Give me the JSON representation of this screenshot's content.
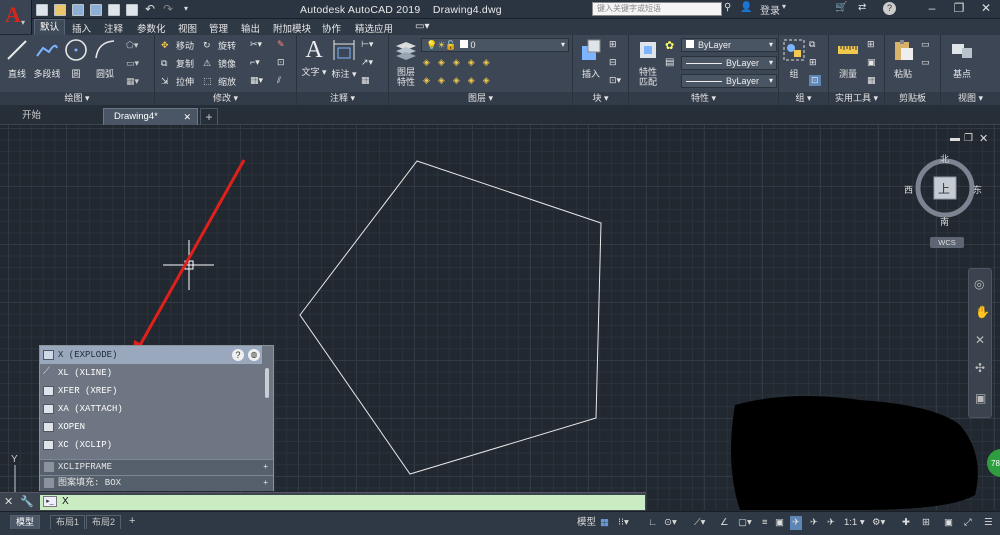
{
  "title_bar": {
    "app_title": "Autodesk AutoCAD 2019",
    "document_title": "Drawing4.dwg",
    "search_placeholder": "键入关键字或短语",
    "login_label": "登录"
  },
  "menu_tabs": [
    "默认",
    "插入",
    "注释",
    "参数化",
    "视图",
    "管理",
    "输出",
    "附加模块",
    "协作",
    "精选应用"
  ],
  "ribbon": {
    "draw": {
      "title": "绘图",
      "line": "直线",
      "polyline": "多段线",
      "circle": "圆",
      "arc": "圆弧"
    },
    "modify": {
      "title": "修改",
      "move": "移动",
      "rotate": "旋转",
      "copy": "复制",
      "mirror": "镜像",
      "stretch": "拉伸",
      "scale": "缩放"
    },
    "annotation": {
      "title": "注释",
      "text": "文字",
      "dimension": "标注"
    },
    "layers": {
      "title": "图层",
      "layer_properties": "图层\n特性",
      "current_layer": "0"
    },
    "block": {
      "title": "块",
      "insert": "插入"
    },
    "properties": {
      "title": "特性",
      "match": "特性\n匹配",
      "color": "ByLayer",
      "linetype": "ByLayer",
      "lineweight": "ByLayer"
    },
    "groups": {
      "title": "组",
      "group": "组"
    },
    "utilities": {
      "title": "实用工具",
      "measure": "测量"
    },
    "clipboard": {
      "title": "剪贴板",
      "paste": "粘贴"
    },
    "view": {
      "title": "视图",
      "base": "基点"
    }
  },
  "file_tabs": {
    "start": "开始",
    "drawing": "Drawing4*"
  },
  "viewcube": {
    "north": "北",
    "south": "南",
    "east": "东",
    "west": "西",
    "face": "上",
    "wcs": "WCS"
  },
  "autocomplete": {
    "items": [
      "X (EXPLODE)",
      "XL (XLINE)",
      "XFER (XREF)",
      "XA (XATTACH)",
      "XOPEN",
      "XC (XCLIP)"
    ],
    "sections": [
      "XCLIPFRAME",
      "图案填充: BOX"
    ]
  },
  "command_line": {
    "value": "X"
  },
  "status_bar": {
    "layout_tabs": [
      "模型",
      "布局1",
      "布局2"
    ],
    "model_label": "模型",
    "scale": "1:1"
  },
  "colors": {
    "accent_red": "#d9241d",
    "input_green": "#c9ecc3",
    "arrow_red": "#e0201a"
  }
}
